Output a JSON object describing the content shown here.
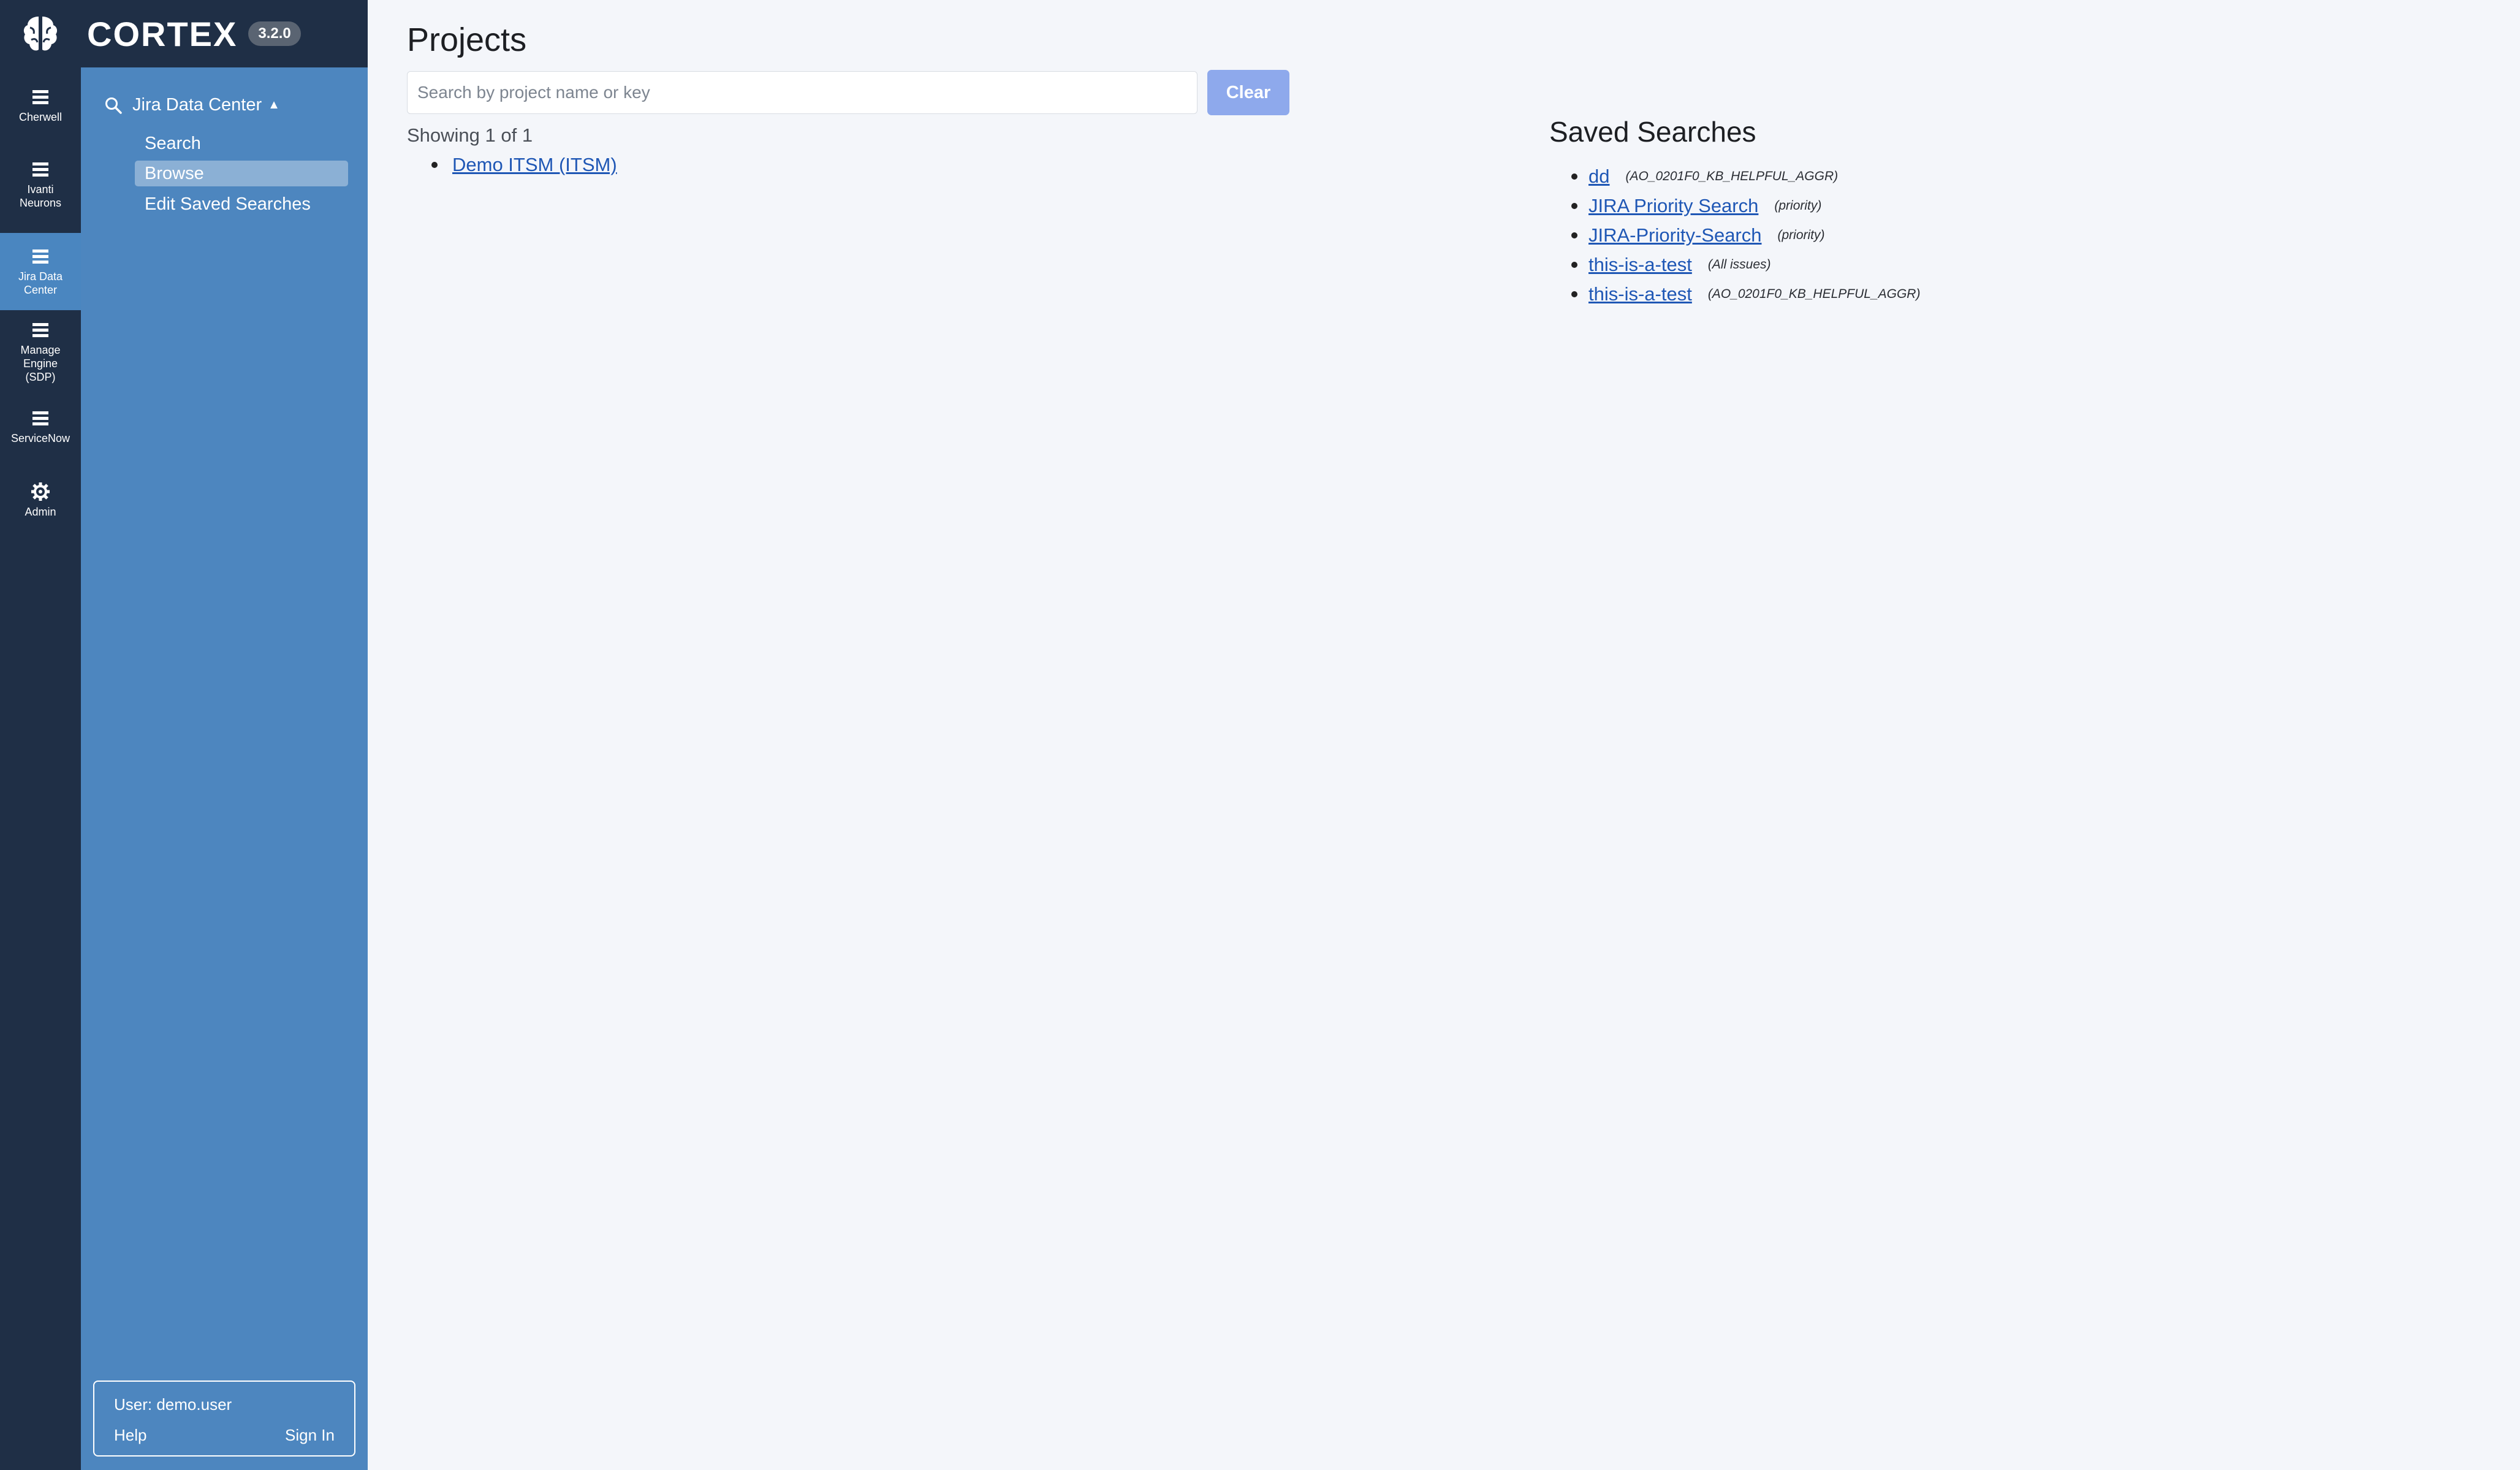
{
  "app": {
    "name": "CORTEX",
    "version": "3.2.0"
  },
  "rail": {
    "items": [
      {
        "label": "Cherwell",
        "icon": "list-icon",
        "active": false
      },
      {
        "label": "Ivanti\nNeurons",
        "icon": "list-icon",
        "active": false
      },
      {
        "label": "Jira Data\nCenter",
        "icon": "list-icon",
        "active": true
      },
      {
        "label": "Manage\nEngine\n(SDP)",
        "icon": "list-icon",
        "active": false
      },
      {
        "label": "ServiceNow",
        "icon": "list-icon",
        "active": false
      },
      {
        "label": "Admin",
        "icon": "gear-icon",
        "active": false
      }
    ]
  },
  "subnav": {
    "header": "Jira Data Center",
    "items": [
      {
        "label": "Search",
        "active": false
      },
      {
        "label": "Browse",
        "active": true
      },
      {
        "label": "Edit Saved Searches",
        "active": false
      }
    ]
  },
  "user": {
    "text": "User: demo.user",
    "help": "Help",
    "sign_in": "Sign In"
  },
  "main": {
    "title": "Projects",
    "search_placeholder": "Search by project name or key",
    "search_value": "",
    "clear_label": "Clear",
    "showing": "Showing 1 of 1",
    "projects": [
      "Demo ITSM (ITSM)"
    ]
  },
  "saved": {
    "title": "Saved Searches",
    "items": [
      {
        "name": "dd",
        "meta": "(AO_0201F0_KB_HELPFUL_AGGR)"
      },
      {
        "name": "JIRA Priority Search",
        "meta": "(priority)"
      },
      {
        "name": "JIRA-Priority-Search",
        "meta": "(priority)"
      },
      {
        "name": "this-is-a-test",
        "meta": "(All issues)"
      },
      {
        "name": "this-is-a-test",
        "meta": "(AO_0201F0_KB_HELPFUL_AGGR)"
      }
    ]
  },
  "colors": {
    "rail_bg": "#1f2f46",
    "subnav_bg": "#4d86bf",
    "active_rail": "#4a86c0",
    "clear_button": "#8ea9ec",
    "link": "#1f57b5"
  }
}
